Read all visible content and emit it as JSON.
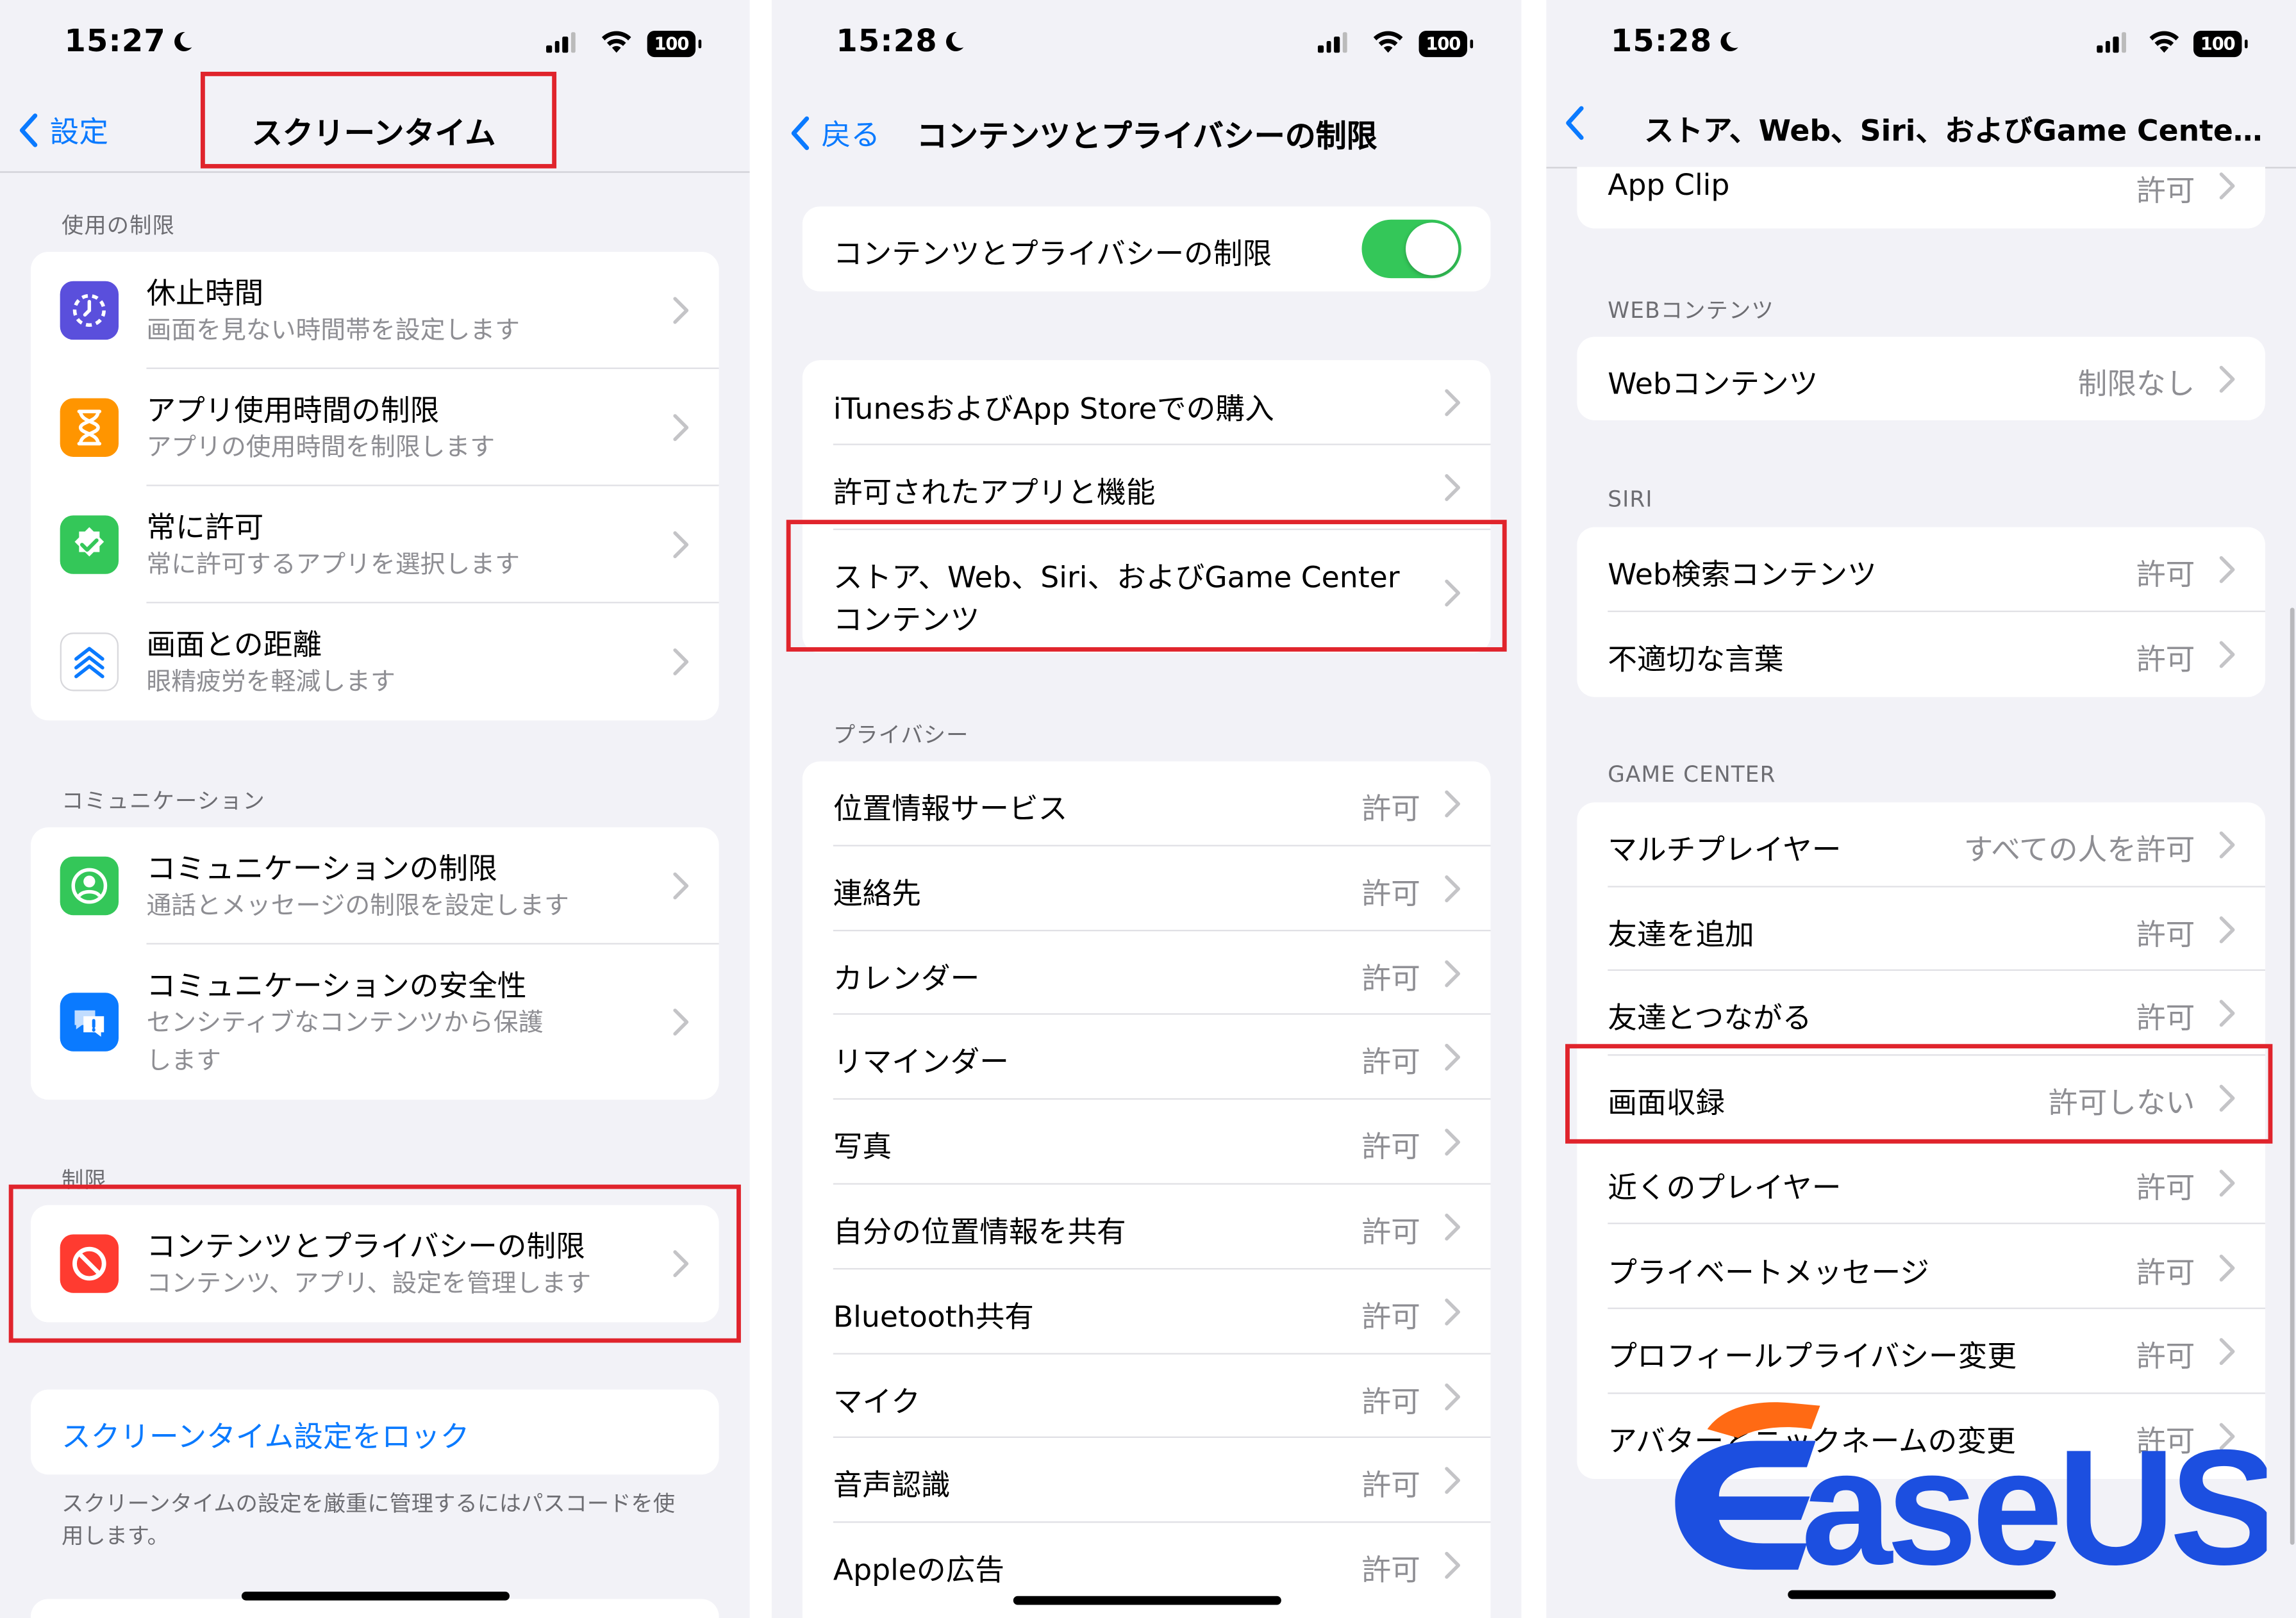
{
  "colors": {
    "accent": "#0a7aff",
    "highlight": "#e0242c",
    "toggle_on": "#34c759",
    "logo_blue": "#1c4fe0",
    "logo_orange": "#ff6a14"
  },
  "screen1": {
    "time": "15:27",
    "battery": "100",
    "back_label": "設定",
    "title": "スクリーンタイム",
    "sections": {
      "usage": "使用の制限",
      "communication": "コミュニケーション",
      "restrictions": "制限"
    },
    "usage_items": [
      {
        "icon": "downtime-icon",
        "title": "休止時間",
        "subtitle": "画面を見ない時間帯を設定します"
      },
      {
        "icon": "hourglass-icon",
        "title": "アプリ使用時間の制限",
        "subtitle": "アプリの使用時間を制限します"
      },
      {
        "icon": "checkmark-badge-icon",
        "title": "常に許可",
        "subtitle": "常に許可するアプリを選択します"
      },
      {
        "icon": "screen-distance-icon",
        "title": "画面との距離",
        "subtitle": "眼精疲労を軽減します"
      }
    ],
    "comm_items": [
      {
        "icon": "person-circle-icon",
        "title": "コミュニケーションの制限",
        "subtitle": "通話とメッセージの制限を設定します"
      },
      {
        "icon": "message-alert-icon",
        "title": "コミュニケーションの安全性",
        "subtitle_line1": "センシティブなコンテンツから保護",
        "subtitle_line2": "します"
      }
    ],
    "restriction_item": {
      "icon": "no-entry-icon",
      "title": "コンテンツとプライバシーの制限",
      "subtitle": "コンテンツ、アプリ、設定を管理します"
    },
    "lock_link": "スクリーンタイム設定をロック",
    "lock_footer": "スクリーンタイムの設定を厳重に管理するにはパスコードを使用します。"
  },
  "screen2": {
    "time": "15:28",
    "battery": "100",
    "back_label": "戻る",
    "title": "コンテンツとプライバシーの制限",
    "toggle_label": "コンテンツとプライバシーの制限",
    "toggle_on": true,
    "menu_items": [
      {
        "label": "iTunesおよびApp Storeでの購入"
      },
      {
        "label": "許可されたアプリと機能"
      },
      {
        "label_line1": "ストア、Web、Siri、およびGame Center",
        "label_line2": "コンテンツ"
      }
    ],
    "privacy_header": "プライバシー",
    "privacy_items": [
      {
        "label": "位置情報サービス",
        "value": "許可"
      },
      {
        "label": "連絡先",
        "value": "許可"
      },
      {
        "label": "カレンダー",
        "value": "許可"
      },
      {
        "label": "リマインダー",
        "value": "許可"
      },
      {
        "label": "写真",
        "value": "許可"
      },
      {
        "label": "自分の位置情報を共有",
        "value": "許可"
      },
      {
        "label": "Bluetooth共有",
        "value": "許可"
      },
      {
        "label": "マイク",
        "value": "許可"
      },
      {
        "label": "音声認識",
        "value": "許可"
      },
      {
        "label": "Appleの広告",
        "value": "許可"
      }
    ]
  },
  "screen3": {
    "time": "15:28",
    "battery": "100",
    "title": "ストア、Web、Siri、およびGame Cente…",
    "top_item": {
      "label": "App Clip",
      "value": "許可"
    },
    "web_header": "WEBコンテンツ",
    "web_item": {
      "label": "Webコンテンツ",
      "value": "制限なし"
    },
    "siri_header": "SIRI",
    "siri_items": [
      {
        "label": "Web検索コンテンツ",
        "value": "許可"
      },
      {
        "label": "不適切な言葉",
        "value": "許可"
      }
    ],
    "gc_header": "GAME CENTER",
    "gc_items": [
      {
        "label": "マルチプレイヤー",
        "value": "すべての人を許可"
      },
      {
        "label": "友達を追加",
        "value": "許可"
      },
      {
        "label": "友達とつながる",
        "value": "許可"
      },
      {
        "label": "画面収録",
        "value": "許可しない"
      },
      {
        "label": "近くのプレイヤー",
        "value": "許可"
      },
      {
        "label": "プライベートメッセージ",
        "value": "許可"
      },
      {
        "label": "プロフィールプライバシー変更",
        "value": "許可"
      },
      {
        "label": "アバターとニックネームの変更",
        "value": "許可"
      }
    ]
  },
  "watermark": {
    "text": "EaseUS"
  }
}
